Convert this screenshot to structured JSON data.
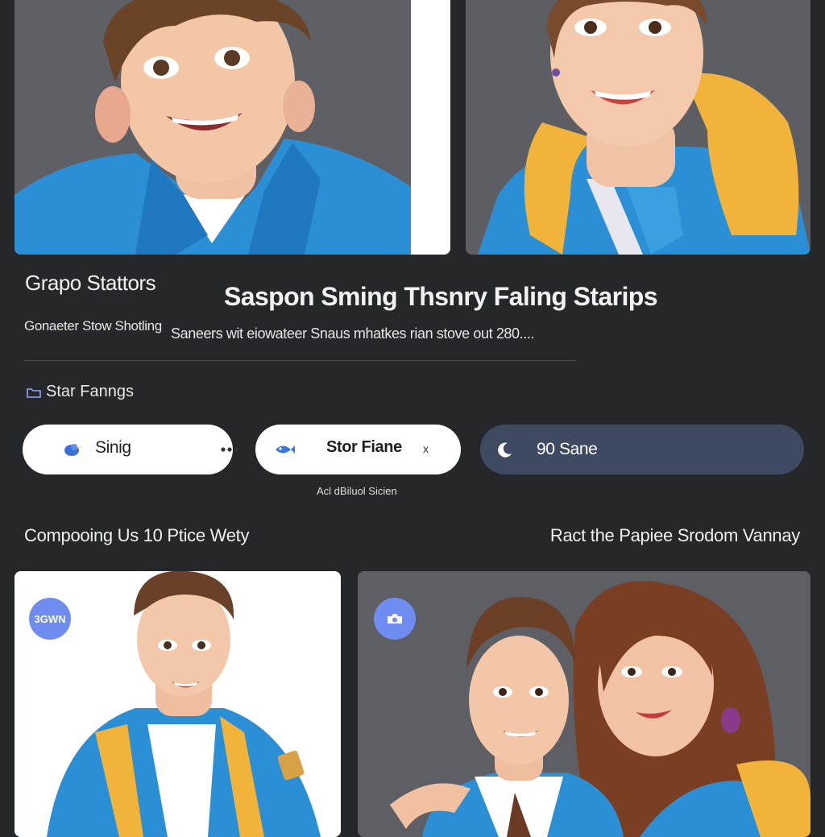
{
  "colors": {
    "background": "#26272b",
    "pill_light": "#ffffff",
    "pill_dark": "#3d4a61",
    "badge": "#6f8cf0",
    "jacket_blue": "#2b8fd6",
    "hood_yellow": "#f2b33a"
  },
  "header": {
    "title_left": "Grapo Stattors",
    "title_main": "Saspon Sming Thsnry Faling Starips",
    "subtitle_left": "Gonaeter Stow Shotling",
    "subtitle_main": "Saneers wit eiowateer Snaus mhatkes rian stove out 280...."
  },
  "section": {
    "icon": "folder-icon",
    "label": "Star Fanngs"
  },
  "pills": [
    {
      "label": "Sinig",
      "icon": "bird-icon",
      "trailing_icon": "more-dots-icon"
    },
    {
      "label": "Stor Fiane",
      "icon": "fish-icon",
      "trailing": "x"
    },
    {
      "label": "90 Sane",
      "icon": "moon-icon"
    }
  ],
  "pill_caption": "Acl dBiluol Sicien",
  "row": {
    "left": "Compooing Us 10 Ptice Wety",
    "right": "Ract the Papiee Srodom Vannay"
  },
  "cards": [
    {
      "badge_text": "3GWN"
    },
    {
      "badge_icon": "camera-icon"
    }
  ]
}
